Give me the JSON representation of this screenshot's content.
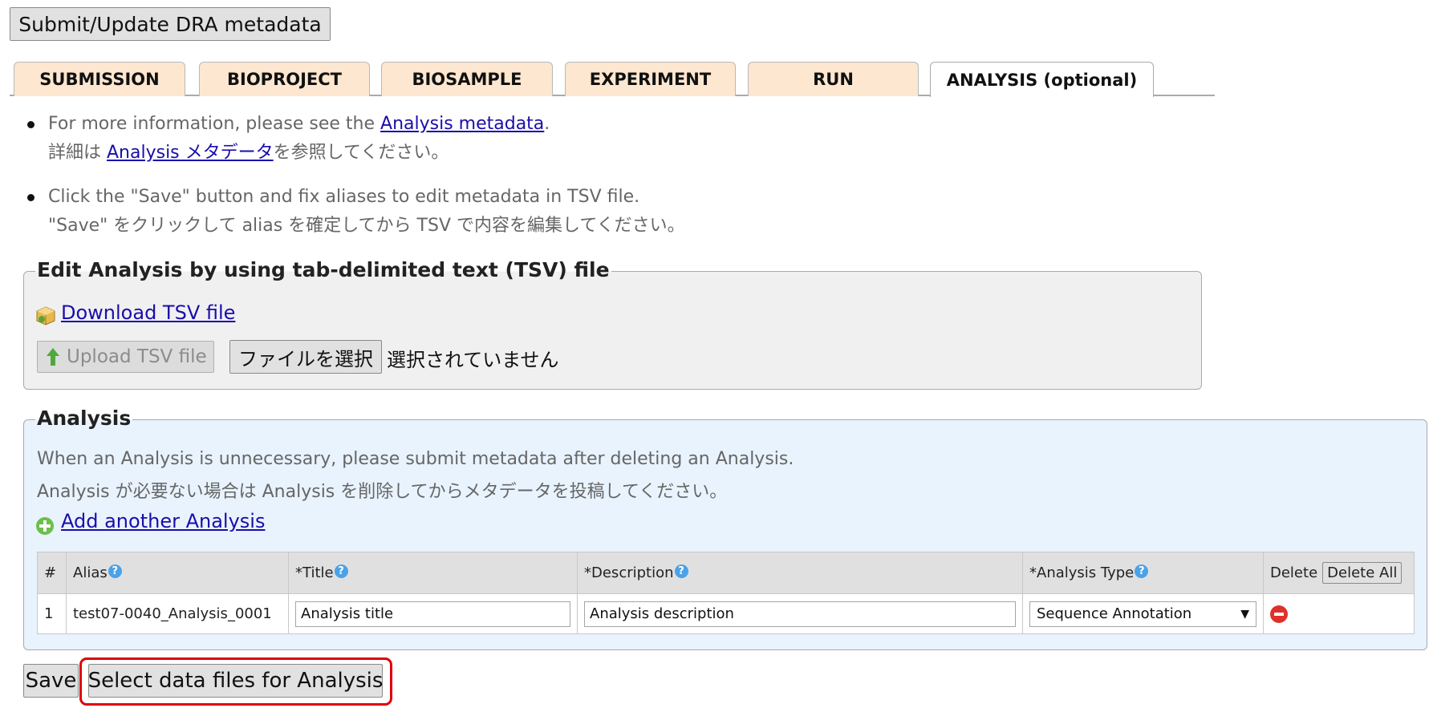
{
  "top_button": "Submit/Update DRA metadata",
  "tabs": [
    {
      "label": "SUBMISSION"
    },
    {
      "label": "BIOPROJECT"
    },
    {
      "label": "BIOSAMPLE"
    },
    {
      "label": "EXPERIMENT"
    },
    {
      "label": "RUN"
    },
    {
      "label": "ANALYSIS (optional)",
      "active": true
    }
  ],
  "info": [
    {
      "pre": "For more information, please see the ",
      "link": "Analysis metadata",
      "post": ".",
      "jp_pre": "詳細は ",
      "jp_link": "Analysis メタデータ",
      "jp_post": "を参照してください。"
    },
    {
      "line1": "Click the \"Save\" button and fix aliases to edit metadata in TSV file.",
      "line2": "\"Save\" をクリックして alias を確定してから TSV で内容を編集してください。"
    }
  ],
  "tsv_section": {
    "legend": "Edit Analysis by using tab-delimited text (TSV) file",
    "download_link": "Download TSV file",
    "upload_button": "Upload TSV file",
    "choose_file_button": "ファイルを選択",
    "no_file_text": "選択されていません"
  },
  "analysis_section": {
    "legend": "Analysis",
    "note_en": "When an Analysis is unnecessary, please submit metadata after deleting an Analysis.",
    "note_jp": "Analysis が必要ない場合は Analysis を削除してからメタデータを投稿してください。",
    "add_link": "Add another Analysis",
    "table": {
      "headers": {
        "num": "#",
        "alias": "Alias",
        "title": "*Title",
        "description": "*Description",
        "type": "*Analysis Type",
        "delete": "Delete",
        "delete_all": "Delete All"
      },
      "rows": [
        {
          "num": "1",
          "alias": "test07-0040_Analysis_0001",
          "title": "Analysis title",
          "description": "Analysis description",
          "type": "Sequence Annotation"
        }
      ]
    }
  },
  "bottom": {
    "save_button": "Save",
    "select_files_button": "Select data files for Analysis"
  },
  "colors": {
    "tab_bg": "#fde7d0",
    "link": "#1a0dab",
    "analysis_bg": "#e8f3fd",
    "highlight": "#e0000a"
  },
  "icons": [
    "package-icon",
    "upload-arrow-icon",
    "add-circle-icon",
    "help-icon",
    "delete-icon"
  ]
}
